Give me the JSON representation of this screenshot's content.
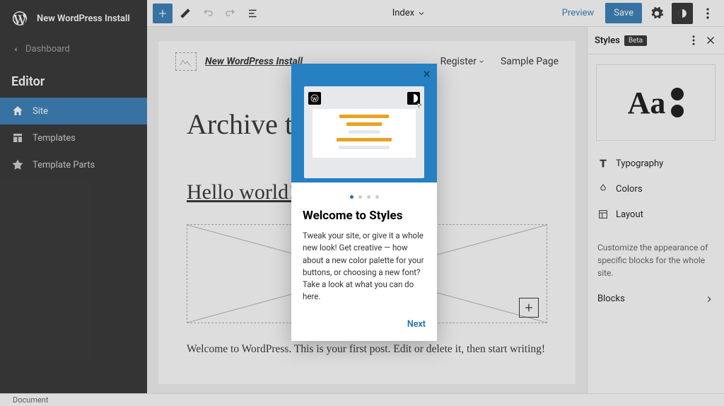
{
  "sidebar": {
    "site_title": "New WordPress Install",
    "back_label": "Dashboard",
    "editor_label": "Editor",
    "nav": [
      {
        "label": "Site"
      },
      {
        "label": "Templates"
      },
      {
        "label": "Template Parts"
      }
    ]
  },
  "toolbar": {
    "center_label": "Index",
    "preview_label": "Preview",
    "save_label": "Save"
  },
  "canvas": {
    "brand_link": "New WordPress Install",
    "nav_register": "Register",
    "nav_sample": "Sample Page",
    "archive_title": "Archive title",
    "post_title": "Hello world!",
    "post_excerpt": "Welcome to WordPress. This is your first post. Edit or delete it, then start writing!"
  },
  "right": {
    "title": "Styles",
    "badge": "Beta",
    "preview_text": "Aa",
    "items": [
      {
        "label": "Typography"
      },
      {
        "label": "Colors"
      },
      {
        "label": "Layout"
      }
    ],
    "desc": "Customize the appearance of specific blocks for the whole site.",
    "blocks_label": "Blocks"
  },
  "modal": {
    "title": "Welcome to Styles",
    "text": "Tweak your site, or give it a whole new look! Get creative — how about a new color palette for your buttons, or choosing a new font? Take a look at what you can do here.",
    "next_label": "Next"
  },
  "status": {
    "breadcrumb": "Document"
  },
  "colors": {
    "accent": "#2271b1",
    "dark": "#1e1e1e"
  }
}
